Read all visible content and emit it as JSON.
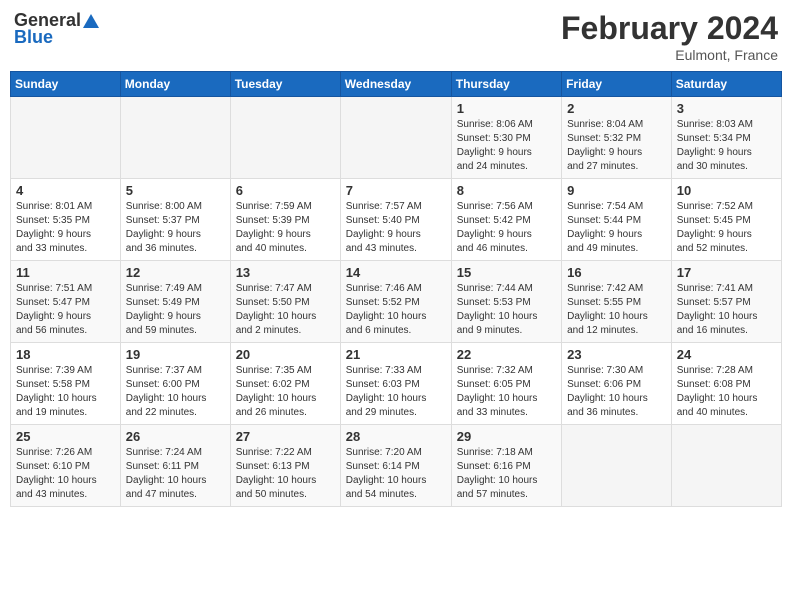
{
  "header": {
    "logo_general": "General",
    "logo_blue": "Blue",
    "month_title": "February 2024",
    "location": "Eulmont, France"
  },
  "days_of_week": [
    "Sunday",
    "Monday",
    "Tuesday",
    "Wednesday",
    "Thursday",
    "Friday",
    "Saturday"
  ],
  "weeks": [
    [
      {
        "day": "",
        "info": ""
      },
      {
        "day": "",
        "info": ""
      },
      {
        "day": "",
        "info": ""
      },
      {
        "day": "",
        "info": ""
      },
      {
        "day": "1",
        "info": "Sunrise: 8:06 AM\nSunset: 5:30 PM\nDaylight: 9 hours\nand 24 minutes."
      },
      {
        "day": "2",
        "info": "Sunrise: 8:04 AM\nSunset: 5:32 PM\nDaylight: 9 hours\nand 27 minutes."
      },
      {
        "day": "3",
        "info": "Sunrise: 8:03 AM\nSunset: 5:34 PM\nDaylight: 9 hours\nand 30 minutes."
      }
    ],
    [
      {
        "day": "4",
        "info": "Sunrise: 8:01 AM\nSunset: 5:35 PM\nDaylight: 9 hours\nand 33 minutes."
      },
      {
        "day": "5",
        "info": "Sunrise: 8:00 AM\nSunset: 5:37 PM\nDaylight: 9 hours\nand 36 minutes."
      },
      {
        "day": "6",
        "info": "Sunrise: 7:59 AM\nSunset: 5:39 PM\nDaylight: 9 hours\nand 40 minutes."
      },
      {
        "day": "7",
        "info": "Sunrise: 7:57 AM\nSunset: 5:40 PM\nDaylight: 9 hours\nand 43 minutes."
      },
      {
        "day": "8",
        "info": "Sunrise: 7:56 AM\nSunset: 5:42 PM\nDaylight: 9 hours\nand 46 minutes."
      },
      {
        "day": "9",
        "info": "Sunrise: 7:54 AM\nSunset: 5:44 PM\nDaylight: 9 hours\nand 49 minutes."
      },
      {
        "day": "10",
        "info": "Sunrise: 7:52 AM\nSunset: 5:45 PM\nDaylight: 9 hours\nand 52 minutes."
      }
    ],
    [
      {
        "day": "11",
        "info": "Sunrise: 7:51 AM\nSunset: 5:47 PM\nDaylight: 9 hours\nand 56 minutes."
      },
      {
        "day": "12",
        "info": "Sunrise: 7:49 AM\nSunset: 5:49 PM\nDaylight: 9 hours\nand 59 minutes."
      },
      {
        "day": "13",
        "info": "Sunrise: 7:47 AM\nSunset: 5:50 PM\nDaylight: 10 hours\nand 2 minutes."
      },
      {
        "day": "14",
        "info": "Sunrise: 7:46 AM\nSunset: 5:52 PM\nDaylight: 10 hours\nand 6 minutes."
      },
      {
        "day": "15",
        "info": "Sunrise: 7:44 AM\nSunset: 5:53 PM\nDaylight: 10 hours\nand 9 minutes."
      },
      {
        "day": "16",
        "info": "Sunrise: 7:42 AM\nSunset: 5:55 PM\nDaylight: 10 hours\nand 12 minutes."
      },
      {
        "day": "17",
        "info": "Sunrise: 7:41 AM\nSunset: 5:57 PM\nDaylight: 10 hours\nand 16 minutes."
      }
    ],
    [
      {
        "day": "18",
        "info": "Sunrise: 7:39 AM\nSunset: 5:58 PM\nDaylight: 10 hours\nand 19 minutes."
      },
      {
        "day": "19",
        "info": "Sunrise: 7:37 AM\nSunset: 6:00 PM\nDaylight: 10 hours\nand 22 minutes."
      },
      {
        "day": "20",
        "info": "Sunrise: 7:35 AM\nSunset: 6:02 PM\nDaylight: 10 hours\nand 26 minutes."
      },
      {
        "day": "21",
        "info": "Sunrise: 7:33 AM\nSunset: 6:03 PM\nDaylight: 10 hours\nand 29 minutes."
      },
      {
        "day": "22",
        "info": "Sunrise: 7:32 AM\nSunset: 6:05 PM\nDaylight: 10 hours\nand 33 minutes."
      },
      {
        "day": "23",
        "info": "Sunrise: 7:30 AM\nSunset: 6:06 PM\nDaylight: 10 hours\nand 36 minutes."
      },
      {
        "day": "24",
        "info": "Sunrise: 7:28 AM\nSunset: 6:08 PM\nDaylight: 10 hours\nand 40 minutes."
      }
    ],
    [
      {
        "day": "25",
        "info": "Sunrise: 7:26 AM\nSunset: 6:10 PM\nDaylight: 10 hours\nand 43 minutes."
      },
      {
        "day": "26",
        "info": "Sunrise: 7:24 AM\nSunset: 6:11 PM\nDaylight: 10 hours\nand 47 minutes."
      },
      {
        "day": "27",
        "info": "Sunrise: 7:22 AM\nSunset: 6:13 PM\nDaylight: 10 hours\nand 50 minutes."
      },
      {
        "day": "28",
        "info": "Sunrise: 7:20 AM\nSunset: 6:14 PM\nDaylight: 10 hours\nand 54 minutes."
      },
      {
        "day": "29",
        "info": "Sunrise: 7:18 AM\nSunset: 6:16 PM\nDaylight: 10 hours\nand 57 minutes."
      },
      {
        "day": "",
        "info": ""
      },
      {
        "day": "",
        "info": ""
      }
    ]
  ]
}
